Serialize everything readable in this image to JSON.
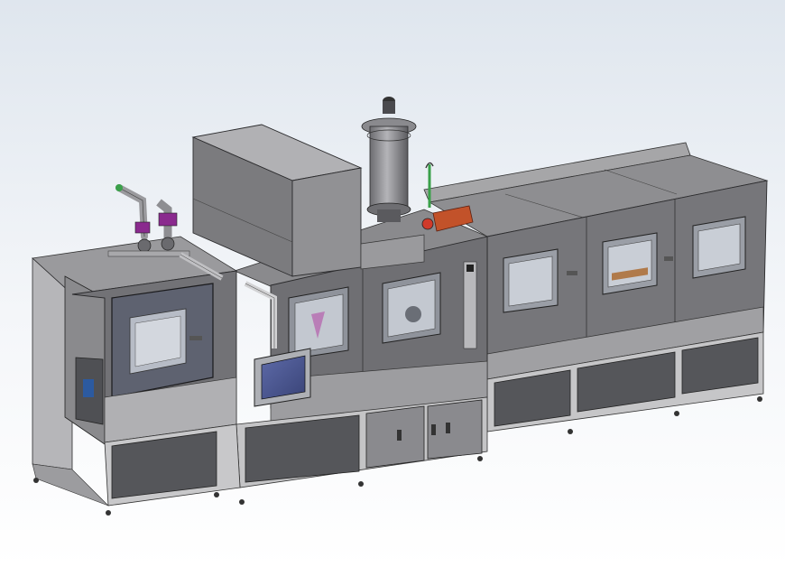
{
  "scene": {
    "subject": "industrial-glovebox-line-cad-render",
    "colors": {
      "background_top": "#dfe6ee",
      "background_bottom": "#ffffff",
      "frame_light": "#9a9a9c",
      "frame_mid": "#7d7d80",
      "frame_dark": "#5b5b5f",
      "cabinet_dark": "#4f5054",
      "window_blue": "#4a5590",
      "accent_orange": "#c2522a",
      "accent_purple": "#8a2a8e",
      "accent_green": "#3aa04a"
    },
    "icons": {
      "main_chamber": "glovebox-chamber",
      "filter_column": "purifier-column",
      "control_screen": "touch-screen-panel",
      "valve_assembly": "valve-pipe-assembly"
    }
  }
}
